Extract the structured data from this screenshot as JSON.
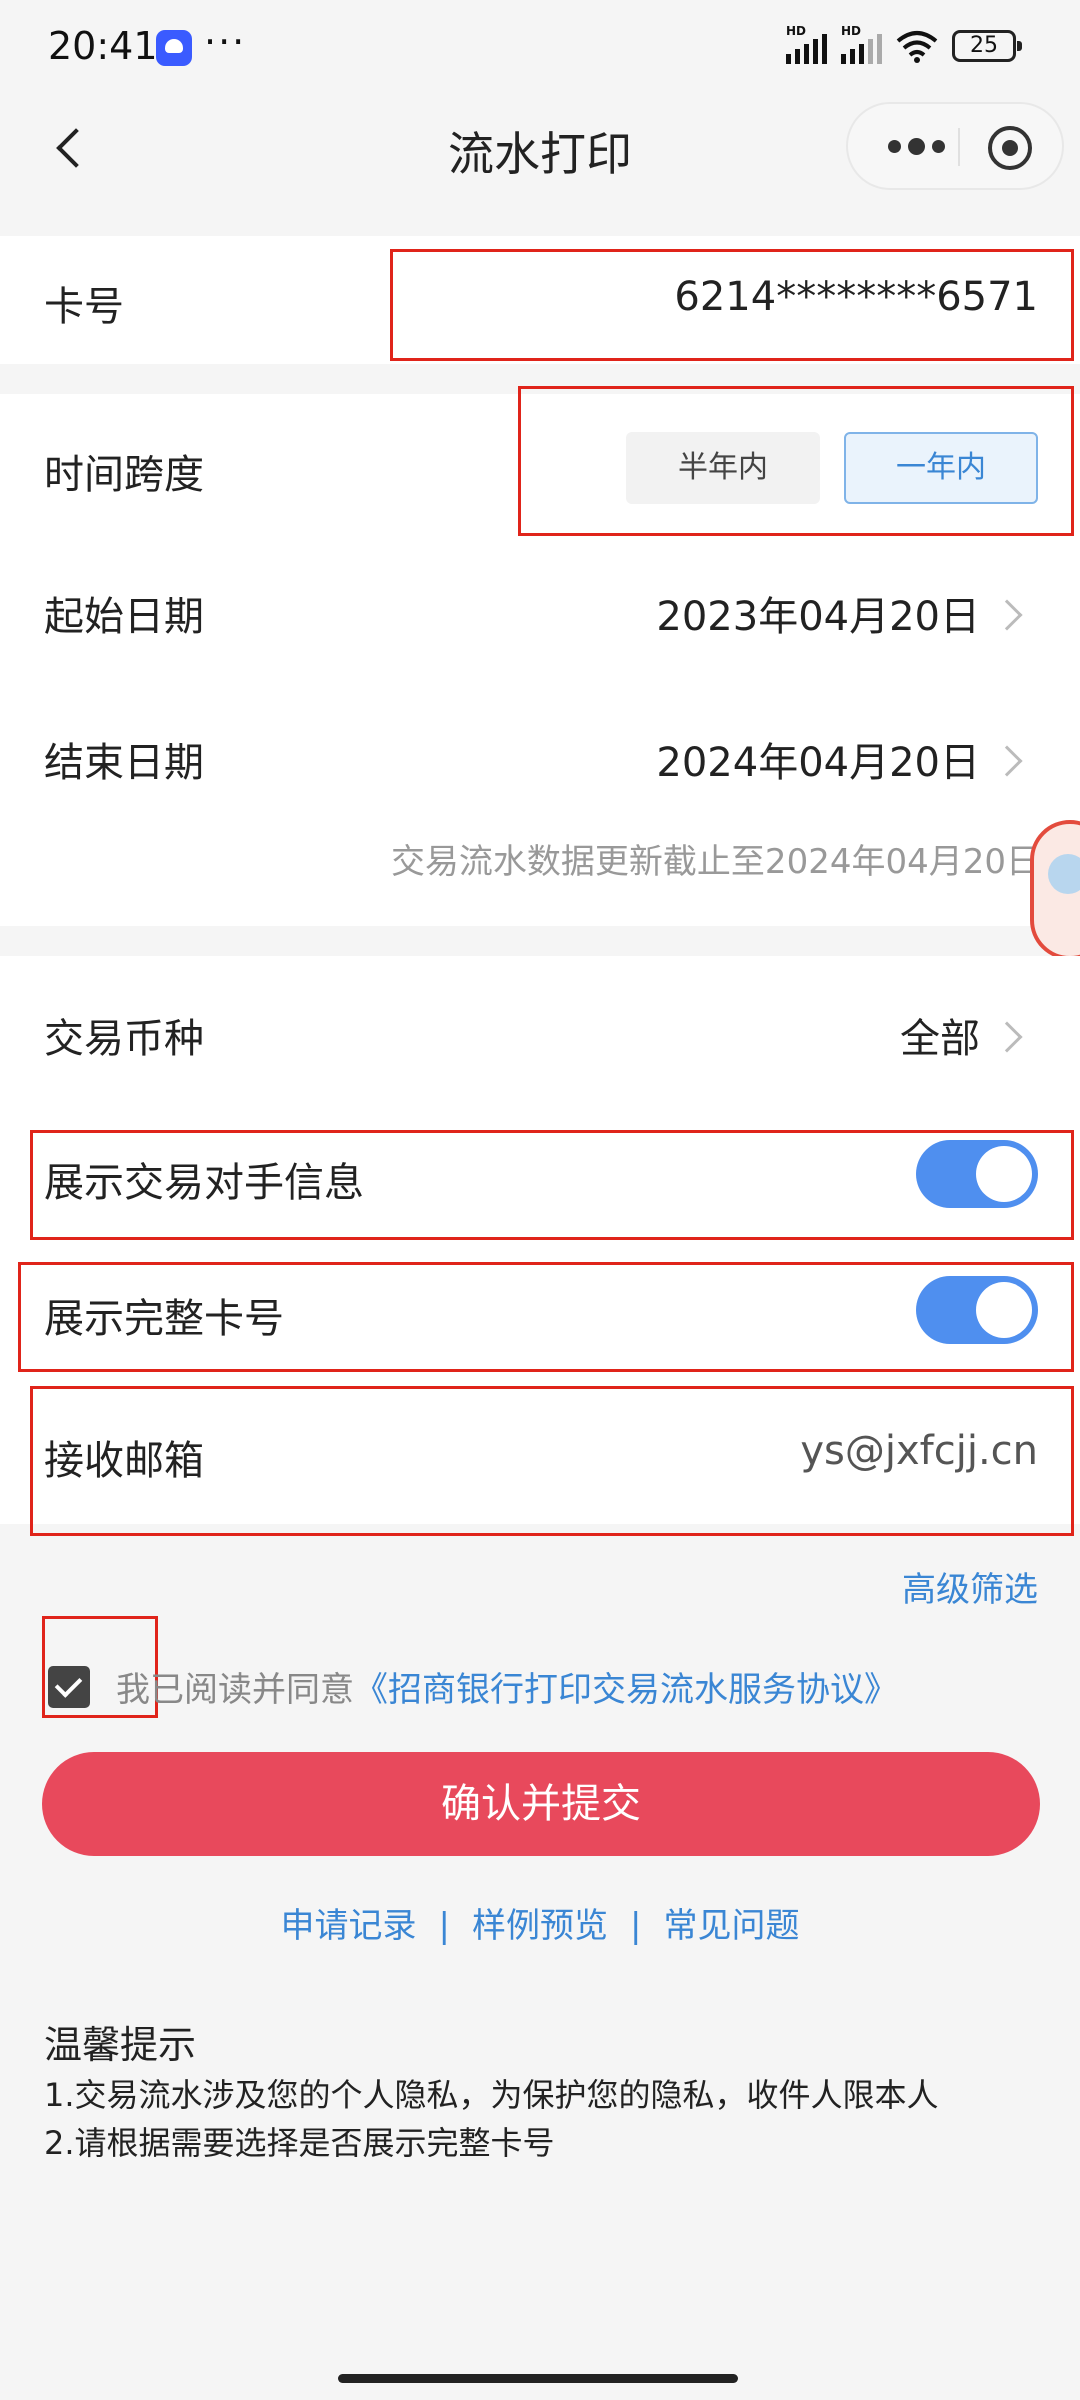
{
  "status_bar": {
    "time": "20:41",
    "more": "···",
    "battery": "25",
    "hd1": "HD",
    "hd2": "HD"
  },
  "nav": {
    "title": "流水打印"
  },
  "card": {
    "label": "卡号",
    "value": "6214********6571"
  },
  "time_span": {
    "label": "时间跨度",
    "options": [
      "半年内",
      "一年内"
    ],
    "selected": "一年内"
  },
  "start_date": {
    "label": "起始日期",
    "value": "2023年04月20日"
  },
  "end_date": {
    "label": "结束日期",
    "value": "2024年04月20日"
  },
  "update_note": "交易流水数据更新截止至2024年04月20日",
  "currency": {
    "label": "交易币种",
    "value": "全部"
  },
  "show_counterparty": {
    "label": "展示交易对手信息",
    "enabled": true
  },
  "show_full_card": {
    "label": "展示完整卡号",
    "enabled": true
  },
  "email": {
    "label": "接收邮箱",
    "value": "ys@jxfcjj.cn"
  },
  "advanced_filter": "高级筛选",
  "agreement": {
    "checked": true,
    "prefix": "我已阅读并同意",
    "link": "《招商银行打印交易流水服务协议》"
  },
  "submit_label": "确认并提交",
  "footer_links": [
    "申请记录",
    "样例预览",
    "常见问题"
  ],
  "link_separator": "|",
  "tips": {
    "title": "温馨提示",
    "items": [
      "1.交易流水涉及您的个人隐私，为保护您的隐私，收件人限本人",
      "2.请根据需要选择是否展示完整卡号"
    ]
  },
  "colors": {
    "accent": "#3a86d4",
    "submit": "#e8495c",
    "toggle": "#4f8fef",
    "highlight": "#e0241a"
  }
}
